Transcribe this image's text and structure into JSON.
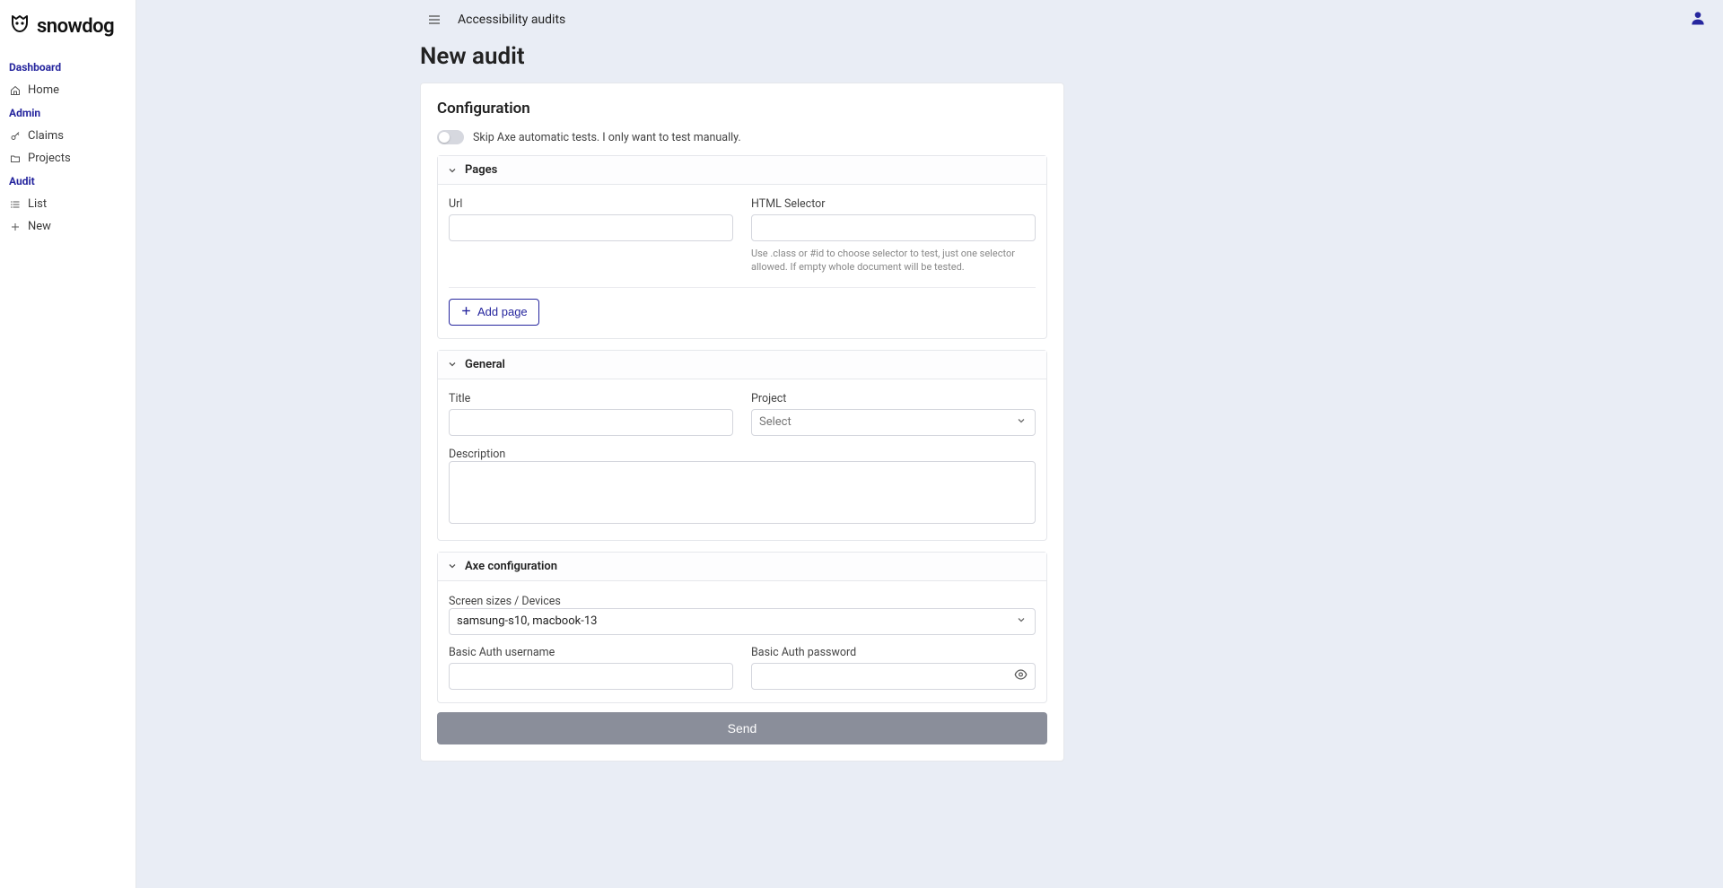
{
  "brand": "snowdog",
  "topbar": {
    "title": "Accessibility audits"
  },
  "sidebar": {
    "sections": [
      {
        "title": "Dashboard",
        "items": [
          {
            "label": "Home",
            "icon": "home"
          }
        ]
      },
      {
        "title": "Admin",
        "items": [
          {
            "label": "Claims",
            "icon": "key"
          },
          {
            "label": "Projects",
            "icon": "folder"
          }
        ]
      },
      {
        "title": "Audit",
        "items": [
          {
            "label": "List",
            "icon": "list"
          },
          {
            "label": "New",
            "icon": "plus"
          }
        ]
      }
    ]
  },
  "page": {
    "title": "New audit",
    "config_heading": "Configuration",
    "toggle_label": "Skip Axe automatic tests. I only want to test manually.",
    "panels": {
      "pages": {
        "title": "Pages",
        "url_label": "Url",
        "selector_label": "HTML Selector",
        "selector_help": "Use .class or #id to choose selector to test, just one selector allowed. If empty whole document will be tested.",
        "add_btn": "Add page"
      },
      "general": {
        "title": "General",
        "title_label": "Title",
        "project_label": "Project",
        "project_placeholder": "Select",
        "description_label": "Description"
      },
      "axe": {
        "title": "Axe configuration",
        "devices_label": "Screen sizes / Devices",
        "devices_value": "samsung-s10, macbook-13",
        "basic_user_label": "Basic Auth username",
        "basic_pass_label": "Basic Auth password"
      }
    },
    "submit": "Send"
  }
}
